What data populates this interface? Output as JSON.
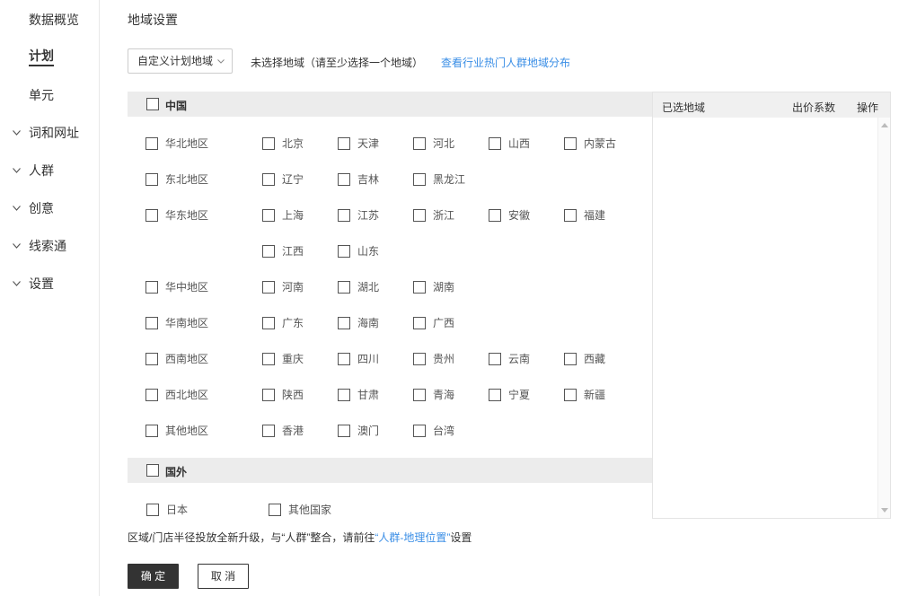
{
  "sidebar": {
    "items": [
      {
        "label": "数据概览",
        "expandable": false,
        "active": false
      },
      {
        "label": "计划",
        "expandable": false,
        "active": true
      },
      {
        "label": "单元",
        "expandable": false,
        "active": false
      },
      {
        "label": "词和网址",
        "expandable": true,
        "active": false
      },
      {
        "label": "人群",
        "expandable": true,
        "active": false
      },
      {
        "label": "创意",
        "expandable": true,
        "active": false
      },
      {
        "label": "线索通",
        "expandable": true,
        "active": false
      },
      {
        "label": "设置",
        "expandable": true,
        "active": false
      }
    ]
  },
  "page": {
    "title": "地域设置",
    "select_value": "自定义计划地域",
    "hint": "未选择地域（请至少选择一个地域）",
    "link": "查看行业热门人群地域分布"
  },
  "china": {
    "label": "中国",
    "rows": [
      {
        "region": "华北地区",
        "provinces": [
          "北京",
          "天津",
          "河北",
          "山西",
          "内蒙古"
        ]
      },
      {
        "region": "东北地区",
        "provinces": [
          "辽宁",
          "吉林",
          "黑龙江"
        ]
      },
      {
        "region": "华东地区",
        "provinces": [
          "上海",
          "江苏",
          "浙江",
          "安徽",
          "福建"
        ]
      },
      {
        "region": "",
        "provinces": [
          "江西",
          "山东"
        ]
      },
      {
        "region": "华中地区",
        "provinces": [
          "河南",
          "湖北",
          "湖南"
        ]
      },
      {
        "region": "华南地区",
        "provinces": [
          "广东",
          "海南",
          "广西"
        ]
      },
      {
        "region": "西南地区",
        "provinces": [
          "重庆",
          "四川",
          "贵州",
          "云南",
          "西藏"
        ]
      },
      {
        "region": "西北地区",
        "provinces": [
          "陕西",
          "甘肃",
          "青海",
          "宁夏",
          "新疆"
        ]
      },
      {
        "region": "其他地区",
        "provinces": [
          "香港",
          "澳门",
          "台湾"
        ]
      }
    ]
  },
  "abroad": {
    "label": "国外",
    "items": [
      "日本",
      "其他国家"
    ]
  },
  "selected_panel": {
    "col_region": "已选地域",
    "col_bid": "出价系数",
    "col_action": "操作"
  },
  "note": {
    "prefix": "区域/门店半径投放全新升级，与“人群”整合，请前往",
    "link": "“人群-地理位置”",
    "suffix": "设置"
  },
  "buttons": {
    "ok": "确 定",
    "cancel": "取 消"
  },
  "colors": {
    "link": "#3a8ee6",
    "primary_button": "#333333",
    "group_header": "#ececec"
  }
}
